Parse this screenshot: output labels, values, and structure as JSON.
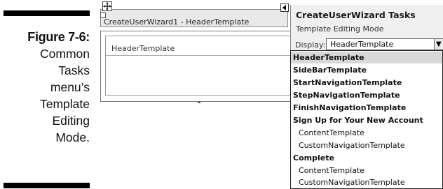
{
  "caption": {
    "figure": "Figure 7-6:",
    "lines": [
      "Common",
      "Tasks",
      "menu’s",
      "Template",
      "Editing",
      "Mode."
    ]
  },
  "designer": {
    "control_title": "CreateUserWizard1 - HeaderTemplate",
    "template_label": "HeaderTemplate"
  },
  "tasks": {
    "title": "CreateUserWizard Tasks",
    "subtitle": "Template Editing Mode",
    "display_label": "Display:",
    "selected_value": "HeaderTemplate"
  },
  "dropdown": {
    "options": [
      {
        "label": "HeaderTemplate",
        "bold": true,
        "selected": true
      },
      {
        "label": "SideBarTemplate",
        "bold": true
      },
      {
        "label": "StartNavigationTemplate",
        "bold": true
      },
      {
        "label": "StepNavigationTemplate",
        "bold": true
      },
      {
        "label": "FinishNavigationTemplate",
        "bold": true
      },
      {
        "label": "Sign Up for Your New Account",
        "bold": true
      },
      {
        "label": "ContentTemplate",
        "indent": true
      },
      {
        "label": "CustomNavigationTemplate",
        "indent": true
      },
      {
        "label": "Complete",
        "bold": true
      },
      {
        "label": "ContentTemplate",
        "indent": true
      },
      {
        "label": "CustomNavigationTemplate",
        "indent": true
      }
    ]
  }
}
